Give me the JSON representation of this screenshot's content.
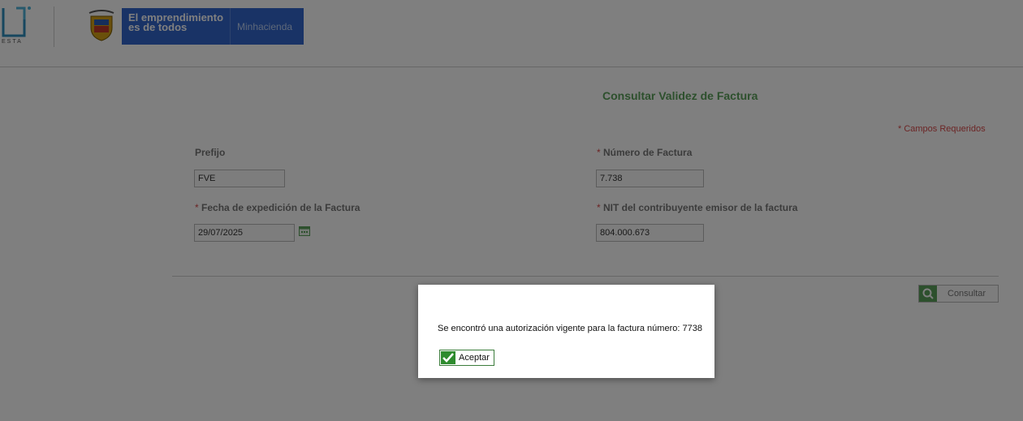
{
  "header": {
    "logo_sub": "ESTA",
    "gov_slogan": "El emprendimiento es de todos",
    "gov_ministry": "Minhacienda"
  },
  "form": {
    "title": "Consultar Validez de Factura",
    "required_note": "* Campos Requeridos",
    "required_mark": "*",
    "prefijo_label": "Prefijo",
    "prefijo_value": "FVE",
    "numero_label": "Número de Factura",
    "numero_value": "7.738",
    "fecha_label": "Fecha de expedición de la Factura",
    "fecha_value": "29/07/2025",
    "nit_label": "NIT del contribuyente emisor de la factura",
    "nit_value": "804.000.673",
    "consultar_label": "Consultar"
  },
  "dialog": {
    "message": "Se encontró una autorización vigente para la factura número: 7738",
    "accept_label": "Aceptar"
  },
  "colors": {
    "accent_green": "#5ba05a",
    "required_red": "#d94a4a",
    "gov_blue": "#3366cc"
  },
  "icons": [
    "logo-icon",
    "coat-of-arms-icon",
    "calendar-icon",
    "search-icon",
    "check-icon"
  ]
}
